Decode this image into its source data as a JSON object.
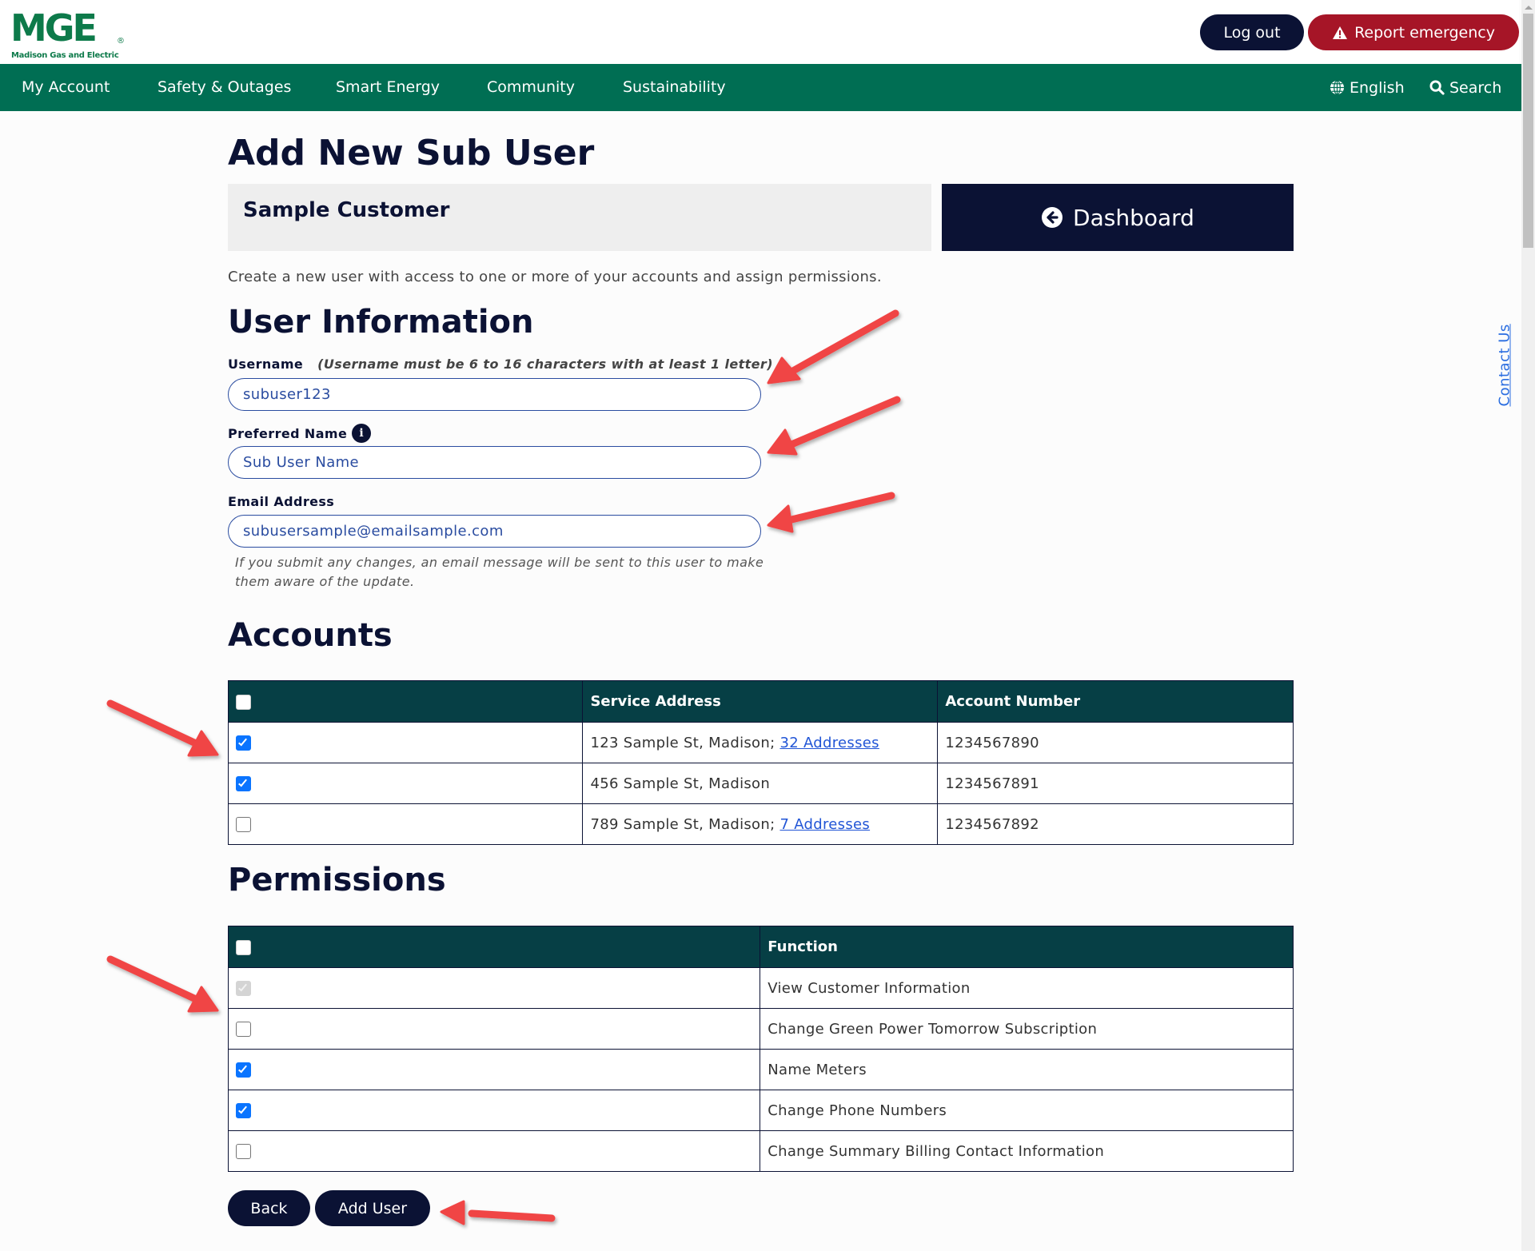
{
  "brand": {
    "logo_text": "MGE",
    "logo_subtitle": "Madison Gas and Electric",
    "registered_mark": "®",
    "colors": {
      "primary_green": "#006e53",
      "navy": "#0b1234",
      "emergency_red": "#a61527",
      "table_header": "#063f45",
      "checkbox_blue": "#0a74ff",
      "annotation_red": "#f04545"
    }
  },
  "header": {
    "logout_label": "Log out",
    "emergency_label": "Report emergency",
    "emergency_icon": "warning-triangle-icon"
  },
  "nav": {
    "items": [
      {
        "label": "My Account"
      },
      {
        "label": "Safety & Outages"
      },
      {
        "label": "Smart Energy"
      },
      {
        "label": "Community"
      },
      {
        "label": "Sustainability"
      }
    ],
    "language": {
      "label": "English",
      "icon": "globe-icon"
    },
    "search": {
      "label": "Search",
      "icon": "search-icon"
    }
  },
  "page": {
    "title": "Add New Sub User",
    "customer_name": "Sample Customer",
    "dashboard_label": "Dashboard",
    "dashboard_icon": "arrow-left-circle-icon",
    "intro": "Create a new user with access to one or more of your accounts and assign permissions.",
    "contact_us": "Contact Us"
  },
  "user_info": {
    "heading": "User Information",
    "username": {
      "label": "Username",
      "hint": "(Username must be 6 to 16 characters with at least 1 letter)",
      "value": "subuser123"
    },
    "preferred_name": {
      "label": "Preferred Name",
      "info_icon": "i",
      "value": "Sub User Name"
    },
    "email": {
      "label": "Email Address",
      "value": "subusersample@emailsample.com",
      "note": "If you submit any changes, an email message will be sent to this user to make them aware of the update."
    }
  },
  "accounts": {
    "heading": "Accounts",
    "columns": [
      "",
      "Service Address",
      "Account Number"
    ],
    "select_all_checked": false,
    "rows": [
      {
        "checked": true,
        "address": "123 Sample St, Madison;",
        "link": "32 Addresses",
        "account_number": "1234567890"
      },
      {
        "checked": true,
        "address": "456 Sample St, Madison",
        "link": "",
        "account_number": "1234567891"
      },
      {
        "checked": false,
        "address": "789 Sample St, Madison;",
        "link": "7 Addresses",
        "account_number": "1234567892"
      }
    ]
  },
  "permissions": {
    "heading": "Permissions",
    "columns": [
      "",
      "Function"
    ],
    "select_all_checked": false,
    "rows": [
      {
        "state": "disabled-checked",
        "function": "View Customer Information"
      },
      {
        "state": "unchecked",
        "function": "Change Green Power Tomorrow Subscription"
      },
      {
        "state": "checked",
        "function": "Name Meters"
      },
      {
        "state": "checked",
        "function": "Change Phone Numbers"
      },
      {
        "state": "unchecked",
        "function": "Change Summary Billing Contact Information"
      }
    ]
  },
  "actions": {
    "back_label": "Back",
    "add_user_label": "Add User"
  }
}
